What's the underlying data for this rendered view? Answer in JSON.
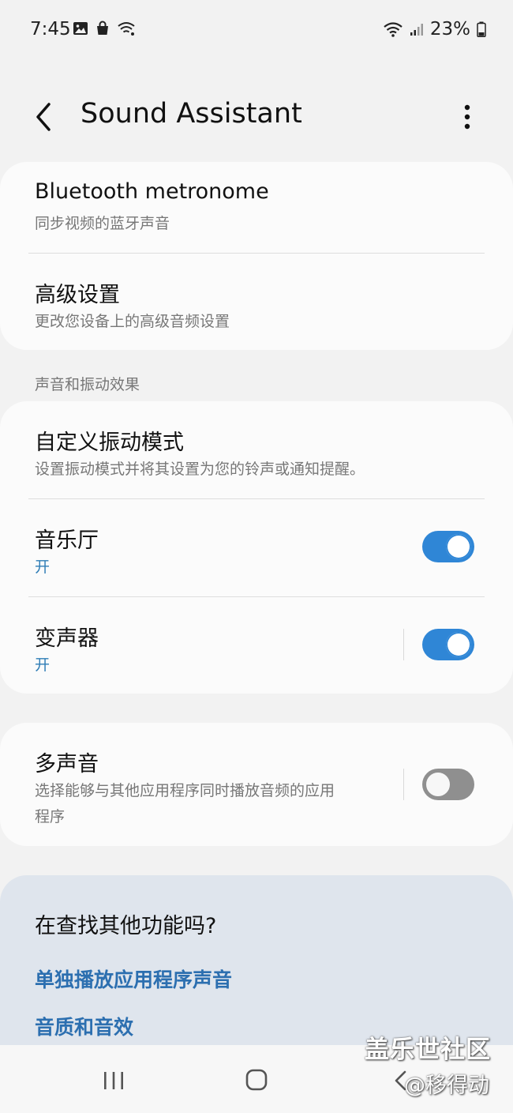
{
  "status_bar": {
    "time": "7:45",
    "battery": "23%",
    "icons": [
      "gallery-icon",
      "shopping-bag-icon",
      "wifi-calling-icon",
      "wifi-icon",
      "signal-icon",
      "battery-icon"
    ]
  },
  "header": {
    "title": "Sound Assistant",
    "back_icon": "back-chevron-icon",
    "more_icon": "more-vert-icon"
  },
  "card1": {
    "items": [
      {
        "label": "Bluetooth metronome",
        "sub": "同步视频的蓝牙声音"
      },
      {
        "label": "高级设置",
        "sub": "更改您设备上的高级音频设置"
      }
    ]
  },
  "section": {
    "header": "声音和振动效果",
    "items": [
      {
        "label": "自定义振动模式",
        "sub": "设置振动模式并将其设置为您的铃声或通知提醒。"
      },
      {
        "label": "音乐厅",
        "sub": "开",
        "toggle": true
      },
      {
        "label": "变声器",
        "sub": "开",
        "toggle": true
      }
    ]
  },
  "card3": {
    "label": "多声音",
    "sub_line1": "选择能够与其他应用程序同时播放音频的应用",
    "sub_line2": "程序",
    "toggle": false
  },
  "suggestions": {
    "question": "在查找其他功能吗?",
    "links": [
      "单独播放应用程序声音",
      "音质和音效"
    ]
  },
  "navbar": {
    "icons": [
      "recent-apps-icon",
      "home-icon",
      "back-icon"
    ]
  },
  "watermark": {
    "line1": "盖乐世社区",
    "line2": "@移得动"
  },
  "colors": {
    "accent": "#2f86d6",
    "link": "#2c6fb0",
    "background": "#f2f2f2",
    "card": "#fbfbfb",
    "suggest_bg": "#dfe5ed"
  }
}
